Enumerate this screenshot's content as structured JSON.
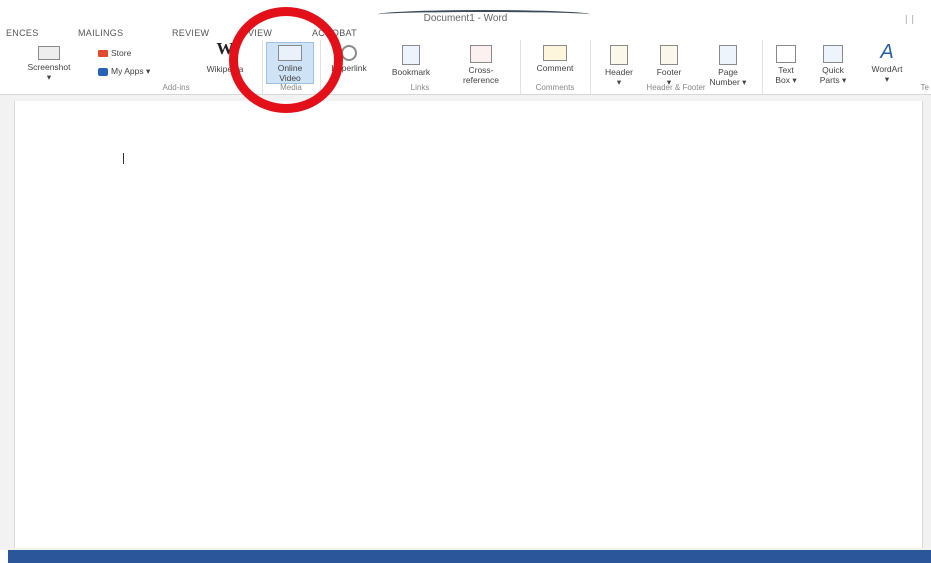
{
  "window": {
    "title": "Document1 - Word",
    "right_controls": "∣∣"
  },
  "tabs": [
    "ENCES",
    "MAILINGS",
    "REVIEW",
    "VIEW",
    "ACROBAT"
  ],
  "ribbon": {
    "groups": {
      "addins": "Add-ins",
      "media": "Media",
      "links": "Links",
      "comments": "Comments",
      "header_footer": "Header & Footer",
      "text": "Te"
    },
    "commands": {
      "screenshot": "Screenshot",
      "store": "Store",
      "my_apps": "My Apps",
      "wikipedia": "Wikipedia",
      "wikipedia_glyph": "W",
      "online_video_1": "Online",
      "online_video_2": "Video",
      "hyperlink": "Hyperlink",
      "bookmark": "Bookmark",
      "cross_ref_1": "Cross-",
      "cross_ref_2": "reference",
      "comment": "Comment",
      "header": "Header",
      "footer": "Footer",
      "page_number_1": "Page",
      "page_number_2": "Number",
      "text_box_1": "Text",
      "text_box_2": "Box",
      "quick_parts_1": "Quick",
      "quick_parts_2": "Parts",
      "wordart": "WordArt",
      "wordart_glyph": "A",
      "dropdown_glyph": "▾"
    }
  },
  "colors": {
    "annotation": "#e3101a",
    "statusbar": "#2b579a",
    "selected": "#cfe3f6"
  }
}
